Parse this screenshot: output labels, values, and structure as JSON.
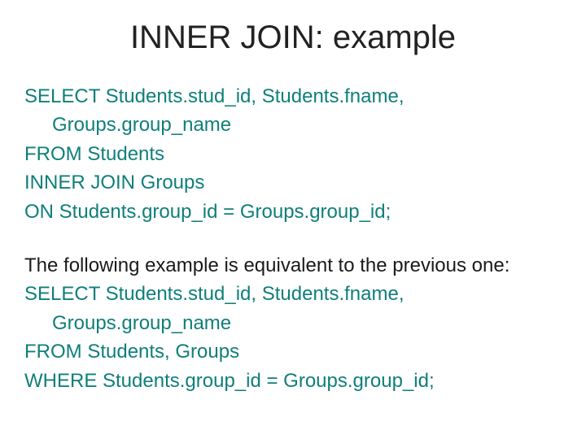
{
  "title": "INNER JOIN: example",
  "sql1": {
    "select_a": "SELECT Students.stud_id, Students.fname,",
    "select_b": "Groups.group_name",
    "from": "FROM Students",
    "join": "INNER JOIN Groups",
    "on": "ON Students.group_id = Groups.group_id;"
  },
  "note": "The following example is equivalent to the previous one:",
  "sql2": {
    "select_a": "SELECT Students.stud_id, Students.fname,",
    "select_b": "Groups.group_name",
    "from": "FROM Students, Groups",
    "where": "WHERE Students.group_id = Groups.group_id;"
  }
}
